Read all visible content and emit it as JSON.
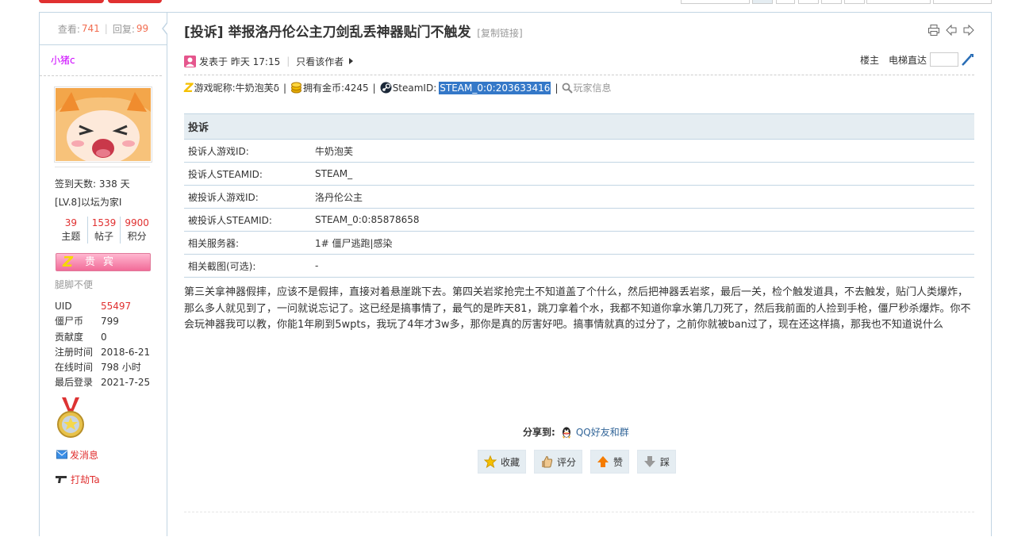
{
  "side": {
    "views_label": "查看:",
    "views": "741",
    "replies_label": "回复:",
    "replies": "99",
    "username": "小猪c",
    "signin": "签到天数: 338 天",
    "level": "[LV.8]以坛为家I",
    "counts": [
      {
        "value": "39",
        "label": "主题"
      },
      {
        "value": "1539",
        "label": "帖子"
      },
      {
        "value": "9900",
        "label": "积分"
      }
    ],
    "vip_label": "贵宾",
    "signature": "腿脚不便",
    "info": [
      {
        "key": "UID",
        "value": "55497",
        "red": true
      },
      {
        "key": "僵尸币",
        "value": "799",
        "red": false
      },
      {
        "key": "贡献度",
        "value": "0",
        "red": false
      },
      {
        "key": "注册时间",
        "value": "2018-6-21",
        "red": false
      },
      {
        "key": "在线时间",
        "value": "798 小时",
        "red": false
      },
      {
        "key": "最后登录",
        "value": "2021-7-25",
        "red": false
      }
    ],
    "send_message": "发消息",
    "rob": "打劫Ta"
  },
  "thread": {
    "title": "[投诉] 举报洛丹伦公主刀剑乱丢神器贴门不触发",
    "copy_link": "[复制链接]"
  },
  "post_meta": {
    "posted": "发表于 昨天 17:15",
    "only_author": "只看该作者",
    "floor": "楼主",
    "jump": "电梯直达"
  },
  "steam_line": {
    "nickname": "游戏昵称:牛奶泡芙δ",
    "coins": "拥有金币:4245",
    "steamid_label": "SteamID:",
    "steamid": "STEAM_0:0:203633416",
    "player_info": "玩家信息"
  },
  "table": {
    "header": "投诉",
    "rows": [
      {
        "k": "投诉人游戏ID:",
        "v": "牛奶泡芙"
      },
      {
        "k": "投诉人STEAMID:",
        "v": "STEAM_"
      },
      {
        "k": "被投诉人游戏ID:",
        "v": "洛丹伦公主"
      },
      {
        "k": "被投诉人STEAMID:",
        "v": "STEAM_0:0:85878658"
      },
      {
        "k": "相关服务器:",
        "v": "1# 僵尸逃跑|感染"
      },
      {
        "k": "相关截图(可选):",
        "v": "-"
      }
    ]
  },
  "content": "第三关拿神器假摔，应该不是假摔，直接对着悬崖跳下去。第四关岩浆抢完土不知道盖了个什么，然后把神器丢岩浆，最后一关，检个触发道具，不去触发，贴门人类爆炸，那么多人就见到了，一问就说忘记了。这已经是搞事情了，最气的是昨天81，跳刀拿着个水，我都不知道你拿水第几刀死了，然后我前面的人捡到手枪，僵尸秒杀爆炸。你不会玩神器我可以教，你能1年刷到5wpts，我玩了4年才3w多，那你是真的厉害好吧。搞事情就真的过分了，之前你就被ban过了，现在还这样搞，那我也不知道说什么",
  "share": {
    "label": "分享到:",
    "qq": "QQ好友和群"
  },
  "actions": {
    "fav": "收藏",
    "rate": "评分",
    "up": "赞",
    "down": "踩"
  },
  "colors": {
    "accent_red": "#e03030",
    "border_blue": "#c2d5e3",
    "panel_bg": "#e5edf2",
    "highlight": "#3478c8"
  }
}
